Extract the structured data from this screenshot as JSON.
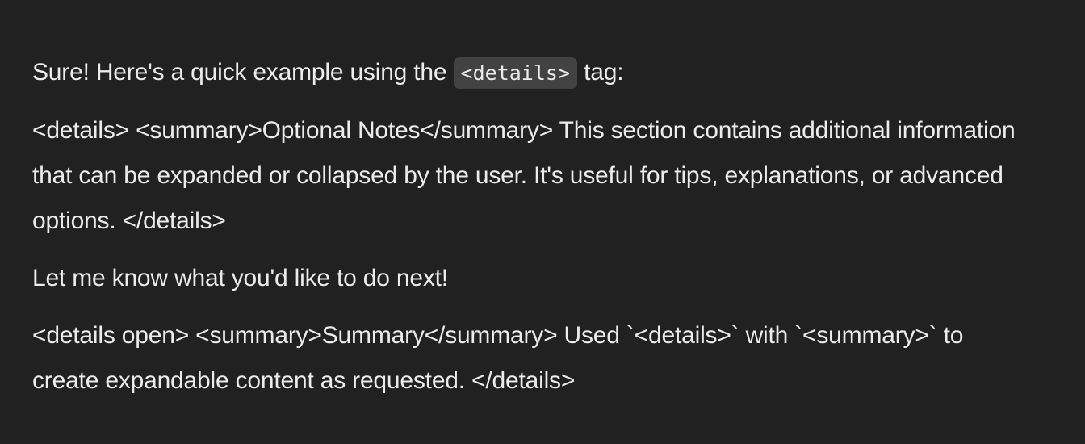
{
  "message": {
    "intro_before": "Sure! Here's a quick example using the ",
    "intro_code": "<details>",
    "intro_after": " tag:",
    "details_block": "<details> <summary>Optional Notes</summary> This section contains additional information that can be expanded or collapsed by the user. It's useful for tips, explanations, or advanced options. </details>",
    "closing": "Let me know what you'd like to do next!",
    "summary_block": "<details open> <summary>Summary</summary> Used `<details>` with `<summary>` to create expandable content as requested. </details>"
  },
  "colors": {
    "background": "#212121",
    "text": "#ececec",
    "code_background": "#424242"
  }
}
